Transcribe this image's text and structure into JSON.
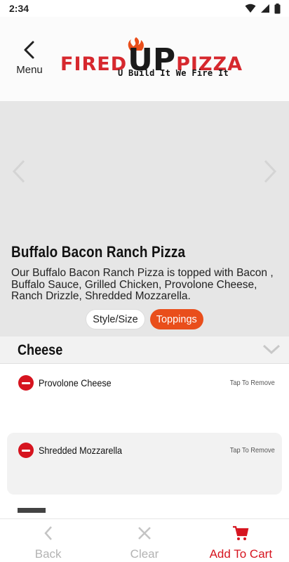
{
  "status_bar": {
    "time": "2:34"
  },
  "header": {
    "menu_label": "Menu",
    "logo": {
      "word_left": "FIRED",
      "word_up": "UP",
      "word_right": "PIZZA",
      "tagline": "U Build It We Fire It"
    }
  },
  "product": {
    "title": "Buffalo Bacon Ranch Pizza",
    "description": "Our Buffalo Bacon Ranch Pizza is topped with Bacon , Buffalo Sauce, Grilled Chicken, Provolone Cheese, Ranch Drizzle, Shredded Mozzarella."
  },
  "tabs": [
    {
      "label": "Style/Size",
      "active": false
    },
    {
      "label": "Toppings",
      "active": true
    }
  ],
  "section": {
    "title": "Cheese",
    "toppings": [
      {
        "name": "Provolone Cheese",
        "action": "Tap To Remove"
      },
      {
        "name": "Shredded Mozzarella",
        "action": "Tap To Remove"
      }
    ]
  },
  "bottom_nav": {
    "back": {
      "label": "Back",
      "icon": "chevron-left-icon"
    },
    "clear": {
      "label": "Clear",
      "icon": "close-icon"
    },
    "cart": {
      "label": "Add To Cart",
      "icon": "cart-icon"
    }
  },
  "colors": {
    "brand_red": "#d6282e",
    "accent_orange": "#e94e1b",
    "remove_red": "#d6141f",
    "muted": "#b3b3b3"
  }
}
